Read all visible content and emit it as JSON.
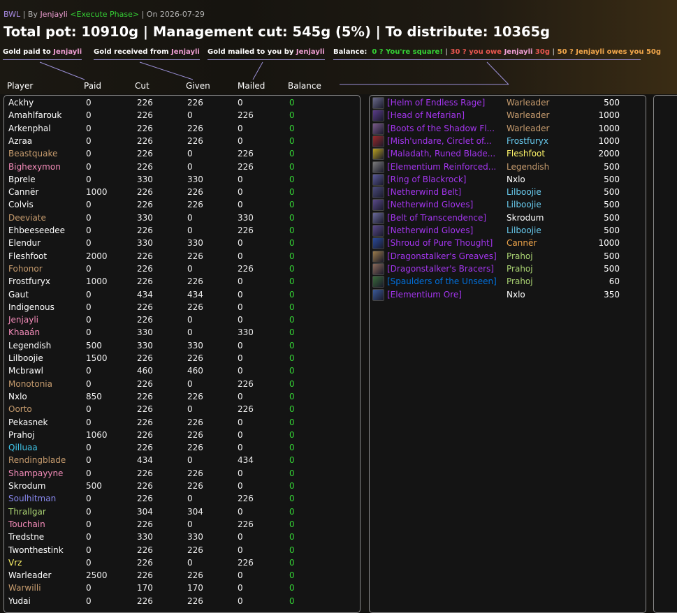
{
  "header": {
    "raid": "BWL",
    "sep1": " | By ",
    "author": "Jenjayli",
    "phase": "<Execute Phase>",
    "sep2": " | On 2026-07-29",
    "summary": "Total pot: 10910g | Management cut: 545g (5%) | To distribute: 10365g"
  },
  "legend": {
    "paid_to_label": "Gold paid to ",
    "received_from_label": "Gold received from ",
    "mailed_by_label": "Gold mailed to you by ",
    "name": "Jenjayli",
    "balance_label": "Balance:",
    "balance_square": "0 ? You're square!",
    "separator": "|",
    "balance_owe_prefix": "30 ? you owe ",
    "balance_owe_suffix": " 30g",
    "balance_owed": "50 ? Jenjayli owes you 50g"
  },
  "columns": {
    "player": "Player",
    "paid": "Paid",
    "cut": "Cut",
    "given": "Given",
    "mailed": "Mailed",
    "balance": "Balance"
  },
  "players": [
    {
      "name": "Ackhy",
      "color": "#ffffff",
      "paid": "0",
      "cut": "226",
      "given": "226",
      "mailed": "0",
      "balance": "0"
    },
    {
      "name": "Amahlfarouk",
      "color": "#ffffff",
      "paid": "0",
      "cut": "226",
      "given": "0",
      "mailed": "226",
      "balance": "0"
    },
    {
      "name": "Arkenphal",
      "color": "#ffffff",
      "paid": "0",
      "cut": "226",
      "given": "226",
      "mailed": "0",
      "balance": "0"
    },
    {
      "name": "Azraa",
      "color": "#ffffff",
      "paid": "0",
      "cut": "226",
      "given": "226",
      "mailed": "0",
      "balance": "0"
    },
    {
      "name": "Beastquake",
      "color": "#c79c6e",
      "paid": "0",
      "cut": "226",
      "given": "0",
      "mailed": "226",
      "balance": "0"
    },
    {
      "name": "Bighexymon",
      "color": "#f58cba",
      "paid": "0",
      "cut": "226",
      "given": "0",
      "mailed": "226",
      "balance": "0"
    },
    {
      "name": "Bprele",
      "color": "#ffffff",
      "paid": "0",
      "cut": "330",
      "given": "330",
      "mailed": "0",
      "balance": "0"
    },
    {
      "name": "Cannër",
      "color": "#ffffff",
      "paid": "1000",
      "cut": "226",
      "given": "226",
      "mailed": "0",
      "balance": "0"
    },
    {
      "name": "Colvis",
      "color": "#ffffff",
      "paid": "0",
      "cut": "226",
      "given": "226",
      "mailed": "0",
      "balance": "0"
    },
    {
      "name": "Deeviate",
      "color": "#c79c6e",
      "paid": "0",
      "cut": "330",
      "given": "0",
      "mailed": "330",
      "balance": "0"
    },
    {
      "name": "Ehbeeseedee",
      "color": "#ffffff",
      "paid": "0",
      "cut": "226",
      "given": "0",
      "mailed": "226",
      "balance": "0"
    },
    {
      "name": "Elendur",
      "color": "#ffffff",
      "paid": "0",
      "cut": "330",
      "given": "330",
      "mailed": "0",
      "balance": "0"
    },
    {
      "name": "Fleshfoot",
      "color": "#ffffff",
      "paid": "2000",
      "cut": "226",
      "given": "226",
      "mailed": "0",
      "balance": "0"
    },
    {
      "name": "Fohonor",
      "color": "#c79c6e",
      "paid": "0",
      "cut": "226",
      "given": "0",
      "mailed": "226",
      "balance": "0"
    },
    {
      "name": "Frostfuryx",
      "color": "#ffffff",
      "paid": "1000",
      "cut": "226",
      "given": "226",
      "mailed": "0",
      "balance": "0"
    },
    {
      "name": "Gaut",
      "color": "#ffffff",
      "paid": "0",
      "cut": "434",
      "given": "434",
      "mailed": "0",
      "balance": "0"
    },
    {
      "name": "Indigenous",
      "color": "#ffffff",
      "paid": "0",
      "cut": "226",
      "given": "226",
      "mailed": "0",
      "balance": "0"
    },
    {
      "name": "Jenjayli",
      "color": "#f58cba",
      "paid": "0",
      "cut": "226",
      "given": "0",
      "mailed": "0",
      "balance": "0"
    },
    {
      "name": "Khaaán",
      "color": "#f58cba",
      "paid": "0",
      "cut": "330",
      "given": "0",
      "mailed": "330",
      "balance": "0"
    },
    {
      "name": "Legendish",
      "color": "#ffffff",
      "paid": "500",
      "cut": "330",
      "given": "330",
      "mailed": "0",
      "balance": "0"
    },
    {
      "name": "Lilboojie",
      "color": "#ffffff",
      "paid": "1500",
      "cut": "226",
      "given": "226",
      "mailed": "0",
      "balance": "0"
    },
    {
      "name": "Mcbrawl",
      "color": "#ffffff",
      "paid": "0",
      "cut": "460",
      "given": "460",
      "mailed": "0",
      "balance": "0"
    },
    {
      "name": "Monotonia",
      "color": "#c79c6e",
      "paid": "0",
      "cut": "226",
      "given": "0",
      "mailed": "226",
      "balance": "0"
    },
    {
      "name": "Nxlo",
      "color": "#ffffff",
      "paid": "850",
      "cut": "226",
      "given": "226",
      "mailed": "0",
      "balance": "0"
    },
    {
      "name": "Oorto",
      "color": "#c79c6e",
      "paid": "0",
      "cut": "226",
      "given": "0",
      "mailed": "226",
      "balance": "0"
    },
    {
      "name": "Pekasnek",
      "color": "#ffffff",
      "paid": "0",
      "cut": "226",
      "given": "226",
      "mailed": "0",
      "balance": "0"
    },
    {
      "name": "Prahoj",
      "color": "#ffffff",
      "paid": "1060",
      "cut": "226",
      "given": "226",
      "mailed": "0",
      "balance": "0"
    },
    {
      "name": "Qilluaa",
      "color": "#40c7eb",
      "paid": "0",
      "cut": "226",
      "given": "226",
      "mailed": "0",
      "balance": "0"
    },
    {
      "name": "Rendingblade",
      "color": "#c79c6e",
      "paid": "0",
      "cut": "434",
      "given": "0",
      "mailed": "434",
      "balance": "0"
    },
    {
      "name": "Shampayyne",
      "color": "#f58cba",
      "paid": "0",
      "cut": "226",
      "given": "226",
      "mailed": "0",
      "balance": "0"
    },
    {
      "name": "Skrodum",
      "color": "#ffffff",
      "paid": "500",
      "cut": "226",
      "given": "226",
      "mailed": "0",
      "balance": "0"
    },
    {
      "name": "Soulhitman",
      "color": "#8787ed",
      "paid": "0",
      "cut": "226",
      "given": "0",
      "mailed": "226",
      "balance": "0"
    },
    {
      "name": "Thrallgar",
      "color": "#abd473",
      "paid": "0",
      "cut": "304",
      "given": "304",
      "mailed": "0",
      "balance": "0"
    },
    {
      "name": "Touchain",
      "color": "#f58cba",
      "paid": "0",
      "cut": "226",
      "given": "0",
      "mailed": "226",
      "balance": "0"
    },
    {
      "name": "Tredstne",
      "color": "#ffffff",
      "paid": "0",
      "cut": "330",
      "given": "330",
      "mailed": "0",
      "balance": "0"
    },
    {
      "name": "Twonthestink",
      "color": "#ffffff",
      "paid": "0",
      "cut": "226",
      "given": "226",
      "mailed": "0",
      "balance": "0"
    },
    {
      "name": "Vrz",
      "color": "#fff569",
      "paid": "0",
      "cut": "226",
      "given": "0",
      "mailed": "226",
      "balance": "0"
    },
    {
      "name": "Warleader",
      "color": "#ffffff",
      "paid": "2500",
      "cut": "226",
      "given": "226",
      "mailed": "0",
      "balance": "0"
    },
    {
      "name": "Warwilli",
      "color": "#c79c6e",
      "paid": "0",
      "cut": "170",
      "given": "170",
      "mailed": "0",
      "balance": "0"
    },
    {
      "name": "Yudai",
      "color": "#ffffff",
      "paid": "0",
      "cut": "226",
      "given": "226",
      "mailed": "0",
      "balance": "0"
    }
  ],
  "items": [
    {
      "icon": "helm-icon",
      "icon_color": "#6a6a8a",
      "name": "[Helm of Endless Rage]",
      "rarity": "epic",
      "winner": "Warleader",
      "winner_color": "#c79c6e",
      "amount": "500"
    },
    {
      "icon": "head-icon",
      "icon_color": "#5a3c8a",
      "name": "[Head of Nefarian]",
      "rarity": "epic",
      "winner": "Warleader",
      "winner_color": "#c79c6e",
      "amount": "1000"
    },
    {
      "icon": "boots-icon",
      "icon_color": "#7a5a8a",
      "name": "[Boots of the Shadow Fl...",
      "rarity": "epic",
      "winner": "Warleader",
      "winner_color": "#c79c6e",
      "amount": "1000"
    },
    {
      "icon": "ring-icon",
      "icon_color": "#9a2a2a",
      "name": "[Mish'undare, Circlet of...",
      "rarity": "epic",
      "winner": "Frostfuryx",
      "winner_color": "#69ccf0",
      "amount": "1000"
    },
    {
      "icon": "sword-icon",
      "icon_color": "#b8a020",
      "name": "[Maladath, Runed Blade...",
      "rarity": "epic",
      "winner": "Fleshfoot",
      "winner_color": "#fff569",
      "amount": "2000"
    },
    {
      "icon": "ore-icon",
      "icon_color": "#7a7a7a",
      "name": "[Elementium Reinforced...",
      "rarity": "epic",
      "winner": "Legendish",
      "winner_color": "#c79c6e",
      "amount": "500"
    },
    {
      "icon": "ring-icon",
      "icon_color": "#5a5a9a",
      "name": "[Ring of Blackrock]",
      "rarity": "epic",
      "winner": "Nxlo",
      "winner_color": "#ffffff",
      "amount": "500"
    },
    {
      "icon": "belt-icon",
      "icon_color": "#4a4a7a",
      "name": "[Netherwind Belt]",
      "rarity": "epic",
      "winner": "Lilboojie",
      "winner_color": "#69ccf0",
      "amount": "500"
    },
    {
      "icon": "gloves-icon",
      "icon_color": "#5a4a8a",
      "name": "[Netherwind Gloves]",
      "rarity": "epic",
      "winner": "Lilboojie",
      "winner_color": "#69ccf0",
      "amount": "500"
    },
    {
      "icon": "belt-icon",
      "icon_color": "#6a6a9a",
      "name": "[Belt of Transcendence]",
      "rarity": "epic",
      "winner": "Skrodum",
      "winner_color": "#ffffff",
      "amount": "500"
    },
    {
      "icon": "gloves-icon",
      "icon_color": "#5a4a8a",
      "name": "[Netherwind Gloves]",
      "rarity": "epic",
      "winner": "Lilboojie",
      "winner_color": "#69ccf0",
      "amount": "500"
    },
    {
      "icon": "cloak-icon",
      "icon_color": "#2a4a9a",
      "name": "[Shroud of Pure Thought]",
      "rarity": "epic",
      "winner": "Cannër",
      "winner_color": "#f2a74b",
      "amount": "1000"
    },
    {
      "icon": "boots-icon",
      "icon_color": "#9a7a4a",
      "name": "[Dragonstalker's Greaves]",
      "rarity": "epic",
      "winner": "Prahoj",
      "winner_color": "#abd473",
      "amount": "500"
    },
    {
      "icon": "bracers-icon",
      "icon_color": "#8a6a5a",
      "name": "[Dragonstalker's Bracers]",
      "rarity": "epic",
      "winner": "Prahoj",
      "winner_color": "#abd473",
      "amount": "500"
    },
    {
      "icon": "shoulder-icon",
      "icon_color": "#3a6a3a",
      "name": "[Spaulders of the Unseen]",
      "rarity": "rare",
      "winner": "Prahoj",
      "winner_color": "#abd473",
      "amount": "60"
    },
    {
      "icon": "ore-icon",
      "icon_color": "#3a5a9a",
      "name": "[Elementium Ore]",
      "rarity": "epic",
      "winner": "Nxlo",
      "winner_color": "#ffffff",
      "amount": "350"
    }
  ]
}
